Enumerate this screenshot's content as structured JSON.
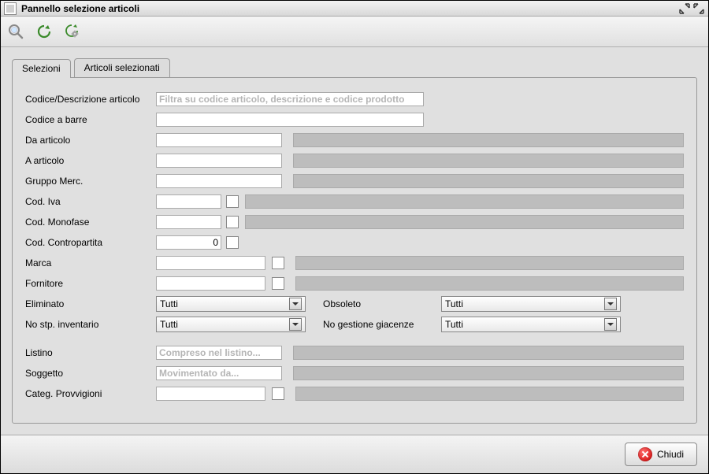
{
  "window": {
    "title": "Pannello selezione articoli"
  },
  "tabs": {
    "selezioni": "Selezioni",
    "articoli_selezionati": "Articoli selezionati"
  },
  "labels": {
    "codice_descr": "Codice/Descrizione articolo",
    "codice_barre": "Codice a barre",
    "da_articolo": "Da articolo",
    "a_articolo": "A articolo",
    "gruppo_merc": "Gruppo Merc.",
    "cod_iva": "Cod. Iva",
    "cod_monofase": "Cod. Monofase",
    "cod_contropartita": "Cod. Contropartita",
    "marca": "Marca",
    "fornitore": "Fornitore",
    "eliminato": "Eliminato",
    "obsoleto": "Obsoleto",
    "no_stp_inventario": "No stp. inventario",
    "no_gestione_giacenze": "No gestione giacenze",
    "listino": "Listino",
    "soggetto": "Soggetto",
    "categ_provvigioni": "Categ. Provvigioni"
  },
  "placeholders": {
    "codice_descr": "Filtra su codice articolo, descrizione e codice prodotto",
    "listino": "Compreso nel listino...",
    "soggetto": "Movimentato da..."
  },
  "values": {
    "cod_contropartita": "0",
    "eliminato": "Tutti",
    "obsoleto": "Tutti",
    "no_stp_inventario": "Tutti",
    "no_gestione_giacenze": "Tutti"
  },
  "buttons": {
    "chiudi": "Chiudi"
  }
}
